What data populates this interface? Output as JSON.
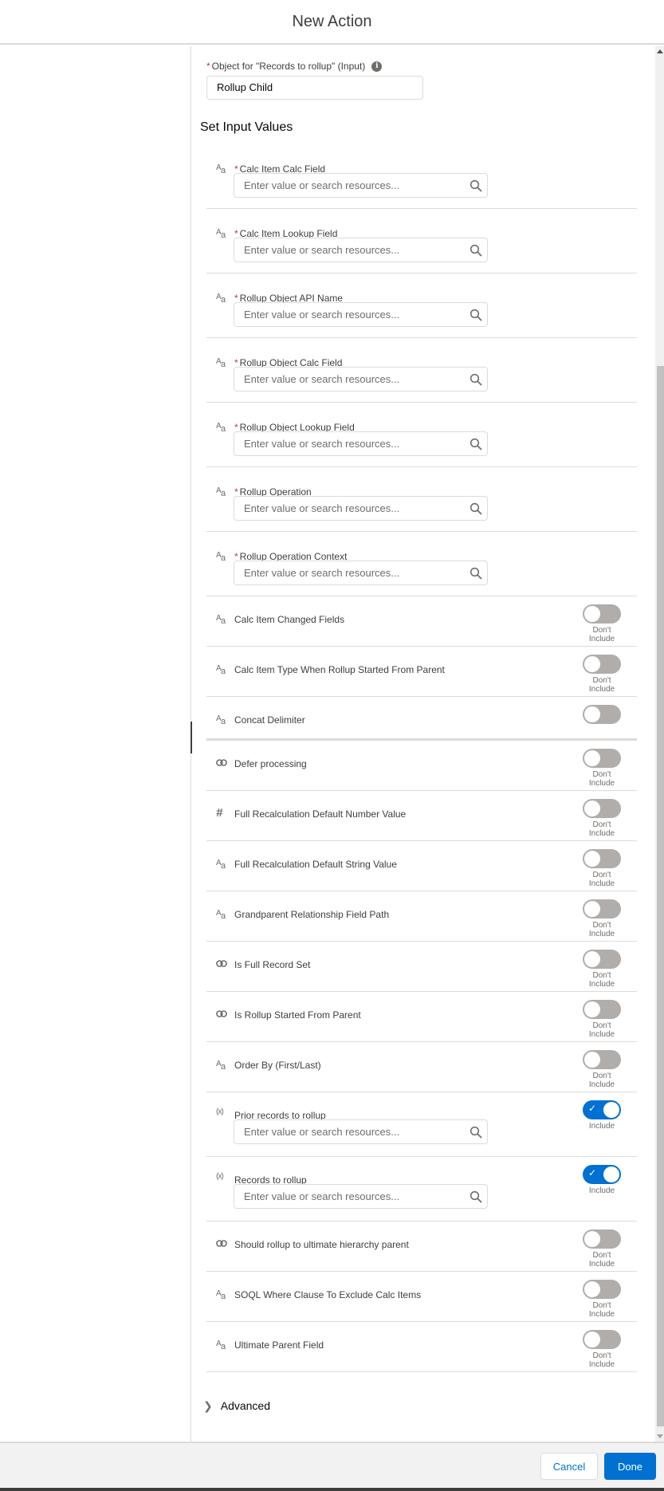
{
  "header": {
    "title": "New Action"
  },
  "object_field": {
    "label": "Object for \"Records to rollup\" (Input)",
    "required_mark": "*",
    "info_icon": "info-icon",
    "value": "Rollup Child"
  },
  "section": {
    "title": "Set Input Values"
  },
  "placeholder": "Enter value or search resources...",
  "required_fields": [
    {
      "label": "Calc Item Calc Field",
      "type": "text",
      "required": true
    },
    {
      "label": "Calc Item Lookup Field",
      "type": "text",
      "required": true
    },
    {
      "label": "Rollup Object API Name",
      "type": "text",
      "required": true
    },
    {
      "label": "Rollup Object Calc Field",
      "type": "text",
      "required": true
    },
    {
      "label": "Rollup Object Lookup Field",
      "type": "text",
      "required": true
    },
    {
      "label": "Rollup Operation",
      "type": "text",
      "required": true
    },
    {
      "label": "Rollup Operation Context",
      "type": "text",
      "required": true
    }
  ],
  "optional_fields": [
    {
      "label": "Calc Item Changed Fields",
      "type": "text",
      "included": false,
      "caption": "Don't Include"
    },
    {
      "label": "Calc Item Type When Rollup Started From Parent",
      "type": "text",
      "included": false,
      "caption": "Don't Include"
    },
    {
      "label": "Concat Delimiter",
      "type": "text",
      "included": false,
      "caption": ""
    },
    {
      "label": "Defer processing",
      "type": "boolean",
      "included": false,
      "caption": "Don't Include"
    },
    {
      "label": "Full Recalculation Default Number Value",
      "type": "number",
      "included": false,
      "caption": "Don't Include"
    },
    {
      "label": "Full Recalculation Default String Value",
      "type": "text",
      "included": false,
      "caption": "Don't Include"
    },
    {
      "label": "Grandparent Relationship Field Path",
      "type": "text",
      "included": false,
      "caption": "Don't Include"
    },
    {
      "label": "Is Full Record Set",
      "type": "boolean",
      "included": false,
      "caption": "Don't Include"
    },
    {
      "label": "Is Rollup Started From Parent",
      "type": "boolean",
      "included": false,
      "caption": "Don't Include"
    },
    {
      "label": "Order By (First/Last)",
      "type": "text",
      "included": false,
      "caption": "Don't Include"
    },
    {
      "label": "Prior records to rollup",
      "type": "variable",
      "included": true,
      "caption": "Include"
    },
    {
      "label": "Records to rollup",
      "type": "variable",
      "included": true,
      "caption": "Include"
    },
    {
      "label": "Should rollup to ultimate hierarchy parent",
      "type": "boolean",
      "included": false,
      "caption": "Don't Include"
    },
    {
      "label": "SOQL Where Clause To Exclude Calc Items",
      "type": "text",
      "included": false,
      "caption": "Don't Include"
    },
    {
      "label": "Ultimate Parent Field",
      "type": "text",
      "included": false,
      "caption": "Don't Include"
    }
  ],
  "advanced": {
    "label": "Advanced",
    "icon": "chevron-right-icon"
  },
  "footer": {
    "cancel_label": "Cancel",
    "done_label": "Done"
  },
  "colors": {
    "brand": "#0070d2",
    "required": "#c23934",
    "toggle_off": "#b0adab",
    "border": "#dddbda"
  }
}
